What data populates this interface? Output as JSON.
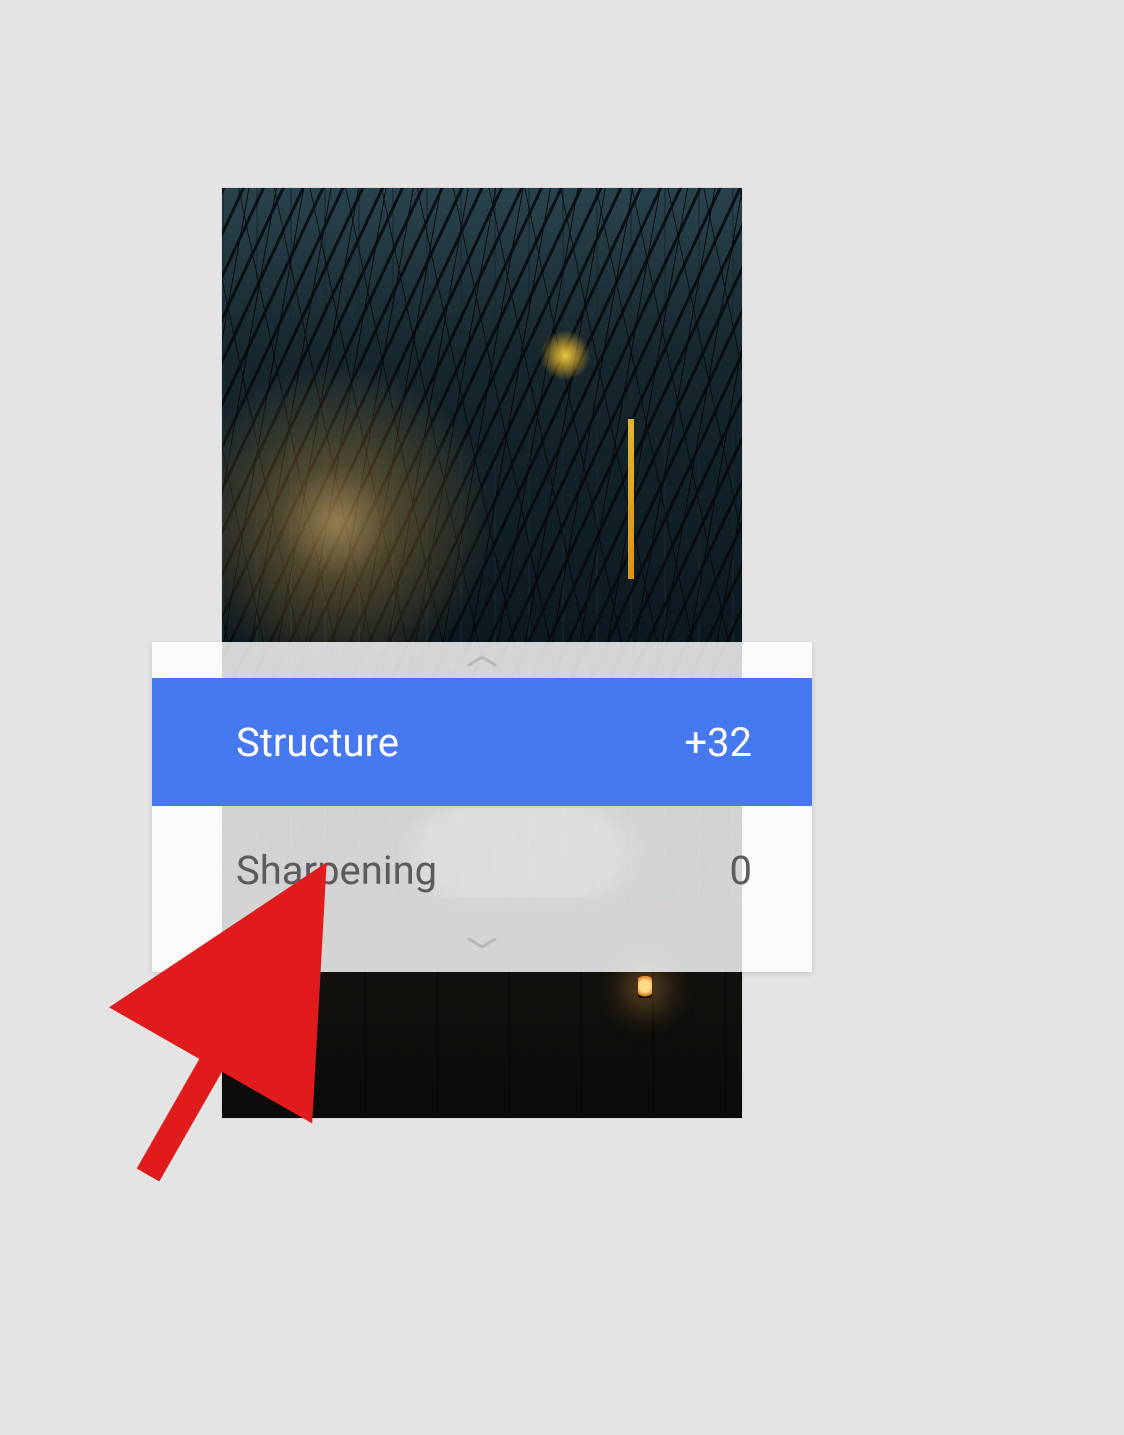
{
  "panel": {
    "rows": [
      {
        "label": "Structure",
        "value": "+32",
        "selected": true
      },
      {
        "label": "Sharpening",
        "value": "0",
        "selected": false
      }
    ]
  },
  "icons": {
    "chevron_up": "chevron-up-icon",
    "chevron_down": "chevron-down-icon"
  },
  "colors": {
    "selected_bg": "#4678f0",
    "selected_fg": "#ffffff",
    "unselected_fg": "#5b5b5b",
    "page_bg": "#e4e4e4",
    "arrow": "#e11b1b"
  },
  "annotation": {
    "type": "arrow",
    "target": "sharpening-row"
  }
}
